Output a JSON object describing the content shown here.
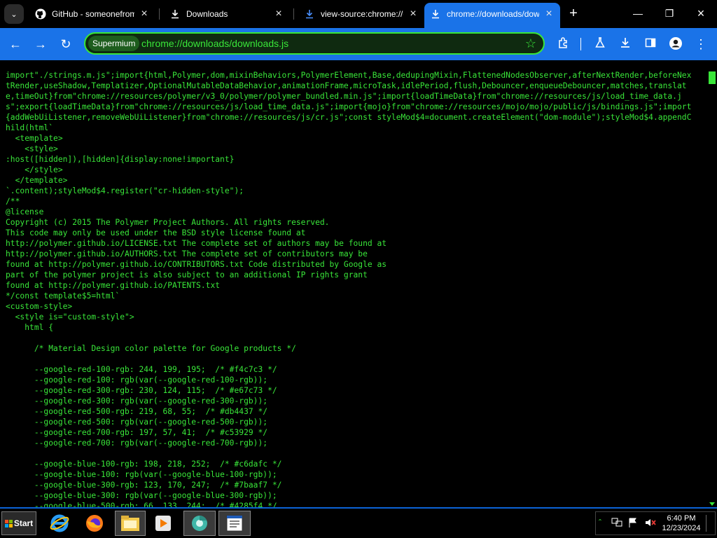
{
  "tabs": [
    {
      "title": "GitHub - someonefromdi",
      "icon": "github-icon",
      "active": false
    },
    {
      "title": "Downloads",
      "icon": "download-icon",
      "active": false
    },
    {
      "title": "view-source:chrome://do",
      "icon": "download-icon",
      "active": false
    },
    {
      "title": "chrome://downloads/dow",
      "icon": "download-icon",
      "active": true
    }
  ],
  "toolbar": {
    "profile_chip": "Supermium",
    "url": "chrome://downloads/downloads.js"
  },
  "source_code": "import\"./strings.m.js\";import{html,Polymer,dom,mixinBehaviors,PolymerElement,Base,dedupingMixin,FlattenedNodesObserver,afterNextRender,beforeNextRender,useShadow,Templatizer,OptionalMutableDataBehavior,animationFrame,microTask,idlePeriod,flush,Debouncer,enqueueDebouncer,matches,translate,timeOut}from\"chrome://resources/polymer/v3_0/polymer/polymer_bundled.min.js\";import{loadTimeData}from\"chrome://resources/js/load_time_data.js\";export{loadTimeData}from\"chrome://resources/js/load_time_data.js\";import{mojo}from\"chrome://resources/mojo/mojo/public/js/bindings.js\";import{addWebUiListener,removeWebUiListener}from\"chrome://resources/js/cr.js\";const styleMod$4=document.createElement(\"dom-module\");styleMod$4.appendChild(html`\n  <template>\n    <style>\n:host([hidden]),[hidden]{display:none!important}\n    </style>\n  </template>\n`.content);styleMod$4.register(\"cr-hidden-style\");\n/**\n@license\nCopyright (c) 2015 The Polymer Project Authors. All rights reserved.\nThis code may only be used under the BSD style license found at\nhttp://polymer.github.io/LICENSE.txt The complete set of authors may be found at\nhttp://polymer.github.io/AUTHORS.txt The complete set of contributors may be\nfound at http://polymer.github.io/CONTRIBUTORS.txt Code distributed by Google as\npart of the polymer project is also subject to an additional IP rights grant\nfound at http://polymer.github.io/PATENTS.txt\n*/const template$5=html`\n<custom-style>\n  <style is=\"custom-style\">\n    html {\n\n      /* Material Design color palette for Google products */\n\n      --google-red-100-rgb: 244, 199, 195;  /* #f4c7c3 */\n      --google-red-100: rgb(var(--google-red-100-rgb));\n      --google-red-300-rgb: 230, 124, 115;  /* #e67c73 */\n      --google-red-300: rgb(var(--google-red-300-rgb));\n      --google-red-500-rgb: 219, 68, 55;  /* #db4437 */\n      --google-red-500: rgb(var(--google-red-500-rgb));\n      --google-red-700-rgb: 197, 57, 41;  /* #c53929 */\n      --google-red-700: rgb(var(--google-red-700-rgb));\n\n      --google-blue-100-rgb: 198, 218, 252;  /* #c6dafc */\n      --google-blue-100: rgb(var(--google-blue-100-rgb));\n      --google-blue-300-rgb: 123, 170, 247;  /* #7baaf7 */\n      --google-blue-300: rgb(var(--google-blue-300-rgb));\n      --google-blue-500-rgb: 66, 133, 244;  /* #4285f4 */",
  "taskbar": {
    "start_label": "Start",
    "apps": [
      "internet-explorer-icon",
      "firefox-icon",
      "file-explorer-icon",
      "media-player-icon",
      "browser-icon",
      "notepad-icon"
    ],
    "clock_time": "6:40 PM",
    "clock_date": "12/23/2024"
  },
  "colors": {
    "accent": "#1a73e8",
    "code_text": "#39e639",
    "background": "#000000"
  }
}
